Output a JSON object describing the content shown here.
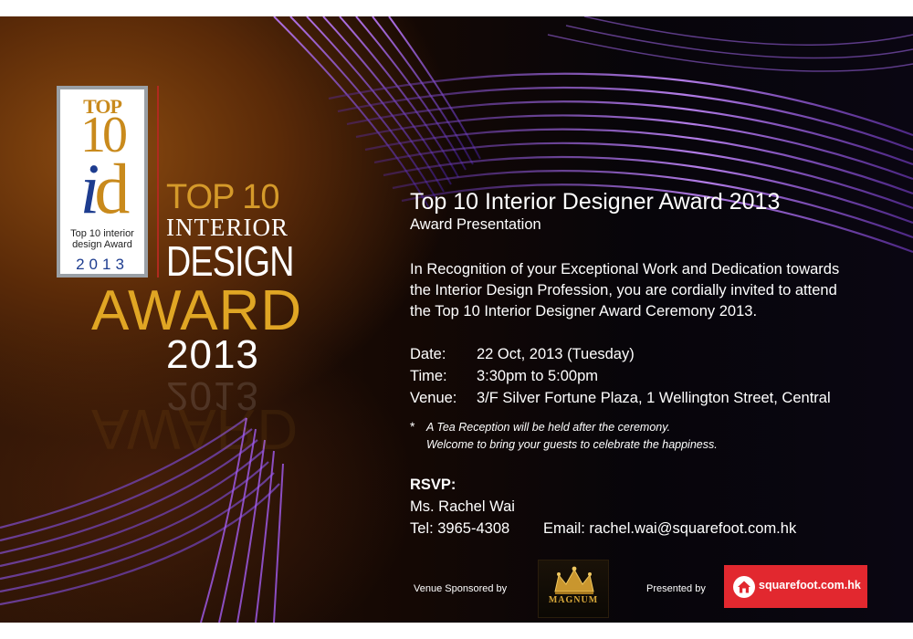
{
  "logo": {
    "top": "TOP",
    "ten": "10",
    "i": "i",
    "d": "d",
    "sub_line1": "Top 10 interior",
    "sub_line2": "design Award",
    "year": "2013"
  },
  "award_title": {
    "top10": "TOP 10",
    "interior": "INTERIOR",
    "design": "DESIGN",
    "award": "AWARD",
    "year": "2013"
  },
  "invitation": {
    "title": "Top 10 Interior Designer Award 2013",
    "subtitle": "Award Presentation",
    "para_line1": "In Recognition of your Exceptional Work and Dedication towards",
    "para_line2": "the Interior Design Profession, you are cordially invited to attend",
    "para_line3": "the Top 10 Interior Designer Award Ceremony 2013."
  },
  "details": {
    "date_label": "Date:",
    "date_value": "22 Oct, 2013 (Tuesday)",
    "time_label": "Time:",
    "time_value": "3:30pm to 5:00pm",
    "venue_label": "Venue:",
    "venue_value": "3/F Silver Fortune Plaza, 1 Wellington Street, Central"
  },
  "note": {
    "star": "*",
    "line1": "A Tea Reception will be held after the ceremony.",
    "line2": "Welcome to bring your guests to celebrate the happiness."
  },
  "rsvp": {
    "label": "RSVP:",
    "name": "Ms. Rachel Wai",
    "tel": "Tel: 3965-4308",
    "email": "Email: rachel.wai@squarefoot.com.hk"
  },
  "footer": {
    "venue_sponsored": "Venue Sponsored by",
    "magnum_logo": "MAGNUM",
    "presented_by": "Presented by",
    "squarefoot_logo": "squarefoot.com.hk"
  },
  "colors": {
    "gold": "#d59a2a",
    "sponsor_red": "#e2282f",
    "purple_streaks": "#9a4fd8"
  }
}
